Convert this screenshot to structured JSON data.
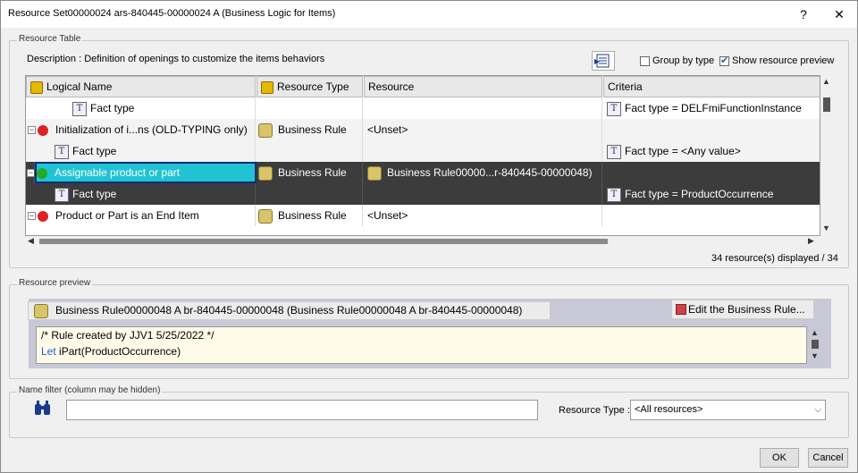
{
  "window": {
    "title": "Resource Set00000024 ars-840445-00000024 A (Business Logic for Items)",
    "help": "?",
    "close": "✕"
  },
  "resource_table": {
    "legend": "Resource Table",
    "description": "Description :  Definition of openings to customize the items behaviors",
    "group_by_type": {
      "label": "Group by type",
      "checked": false
    },
    "show_preview": {
      "label": "Show resource preview",
      "checked": true
    },
    "columns": [
      "Logical Name",
      "Resource Type",
      "Resource",
      "Criteria"
    ],
    "rows": [
      {
        "name": "Fact type",
        "type": "",
        "resource": "",
        "criteria": "Fact type = DELFmiFunctionInstance",
        "kind": "child"
      },
      {
        "name": "Initialization of i...ns (OLD-TYPING only)",
        "type": "Business Rule",
        "resource": "<Unset>",
        "criteria": "",
        "kind": "parent-red"
      },
      {
        "name": "Fact type",
        "type": "",
        "resource": "",
        "criteria": "Fact type = <Any value>",
        "kind": "child"
      },
      {
        "name": "Assignable product or part",
        "type": "Business Rule",
        "resource": "Business Rule00000...r-840445-00000048)",
        "criteria": "",
        "kind": "parent-green-sel"
      },
      {
        "name": "Fact type",
        "type": "",
        "resource": "",
        "criteria": "Fact type = ProductOccurrence",
        "kind": "child-sel"
      },
      {
        "name": "Product or Part is an End Item",
        "type": "Business Rule",
        "resource": "<Unset>",
        "criteria": "",
        "kind": "parent-red"
      }
    ],
    "count": "34 resource(s) displayed / 34"
  },
  "resource_preview": {
    "legend": "Resource preview",
    "rule_name": "Business Rule00000048 A br-840445-00000048 (Business Rule00000048 A br-840445-00000048)",
    "edit_label": "Edit the Business Rule...",
    "code_line1": "/* Rule created by JJV1 5/25/2022 */",
    "code_kw": "Let",
    "code_line2_rest": " iPart(ProductOccurrence)"
  },
  "name_filter": {
    "legend": "Name filter (column may be hidden)",
    "value": "",
    "resource_type_label": "Resource Type :",
    "resource_type_value": "<All resources>"
  },
  "buttons": {
    "ok": "OK",
    "cancel": "Cancel"
  }
}
